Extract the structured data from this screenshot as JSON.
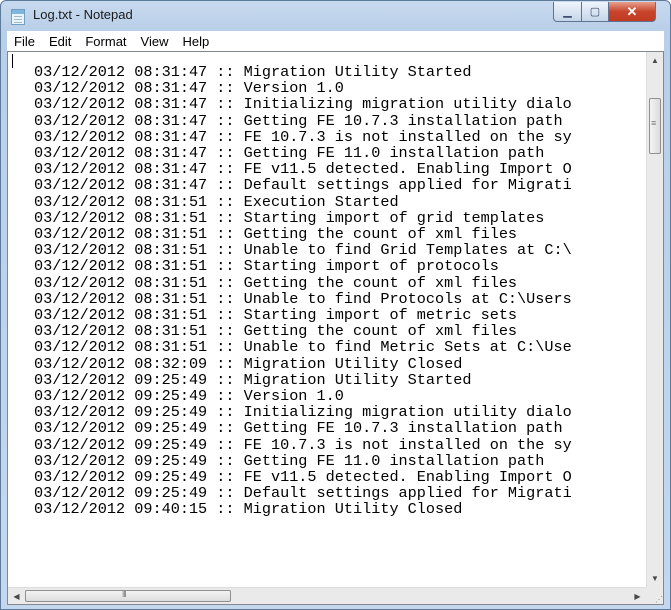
{
  "window": {
    "title": "Log.txt - Notepad",
    "icon": "notepad-icon",
    "controls": {
      "minimize": "minimize-icon",
      "maximize": "maximize-icon",
      "close": "close-icon"
    }
  },
  "menu": [
    "File",
    "Edit",
    "Format",
    "View",
    "Help"
  ],
  "editor": {
    "lines": [
      "03/12/2012 08:31:47 :: Migration Utility Started",
      "03/12/2012 08:31:47 :: Version 1.0",
      "03/12/2012 08:31:47 :: Initializing migration utility dialo",
      "03/12/2012 08:31:47 :: Getting FE 10.7.3 installation path",
      "03/12/2012 08:31:47 :: FE 10.7.3 is not installed on the sy",
      "03/12/2012 08:31:47 :: Getting FE 11.0 installation path",
      "03/12/2012 08:31:47 :: FE v11.5 detected. Enabling Import O",
      "03/12/2012 08:31:47 :: Default settings applied for Migrati",
      "03/12/2012 08:31:51 :: Execution Started",
      "03/12/2012 08:31:51 :: Starting import of grid templates",
      "03/12/2012 08:31:51 :: Getting the count of xml files",
      "03/12/2012 08:31:51 :: Unable to find Grid Templates at C:\\",
      "03/12/2012 08:31:51 :: Starting import of protocols",
      "03/12/2012 08:31:51 :: Getting the count of xml files",
      "03/12/2012 08:31:51 :: Unable to find Protocols at C:\\Users",
      "03/12/2012 08:31:51 :: Starting import of metric sets",
      "03/12/2012 08:31:51 :: Getting the count of xml files",
      "03/12/2012 08:31:51 :: Unable to find Metric Sets at C:\\Use",
      "03/12/2012 08:32:09 :: Migration Utility Closed",
      "03/12/2012 09:25:49 :: Migration Utility Started",
      "03/12/2012 09:25:49 :: Version 1.0",
      "03/12/2012 09:25:49 :: Initializing migration utility dialo",
      "03/12/2012 09:25:49 :: Getting FE 10.7.3 installation path",
      "03/12/2012 09:25:49 :: FE 10.7.3 is not installed on the sy",
      "03/12/2012 09:25:49 :: Getting FE 11.0 installation path",
      "03/12/2012 09:25:49 :: FE v11.5 detected. Enabling Import O",
      "03/12/2012 09:25:49 :: Default settings applied for Migrati",
      "03/12/2012 09:40:15 :: Migration Utility Closed"
    ]
  },
  "scrollbars": {
    "vertical": {
      "up": "scroll-up-arrow-icon",
      "down": "scroll-down-arrow-icon"
    },
    "horizontal": {
      "left": "scroll-left-arrow-icon",
      "right": "scroll-right-arrow-icon"
    }
  }
}
